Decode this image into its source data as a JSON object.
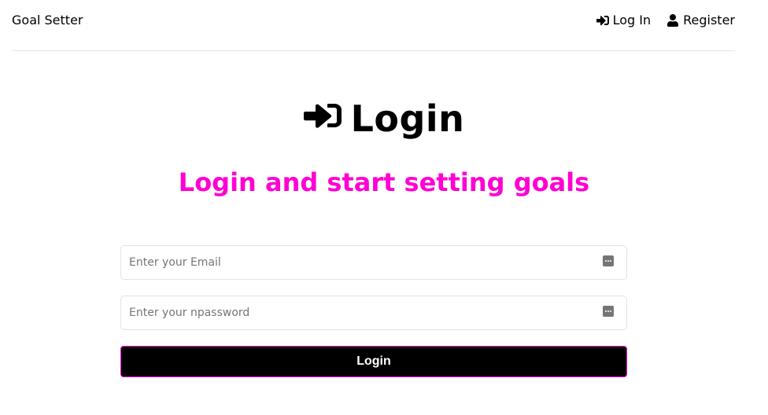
{
  "header": {
    "brand": "Goal Setter",
    "nav": {
      "login_label": "Log In",
      "register_label": "Register"
    }
  },
  "main": {
    "title": "Login",
    "subtitle": "Login and start setting goals",
    "email": {
      "placeholder": "Enter your Email",
      "value": ""
    },
    "password": {
      "placeholder": "Enter your npassword",
      "value": ""
    },
    "submit_label": "Login"
  },
  "colors": {
    "accent": "#ff00d4",
    "button_bg": "#000000",
    "text": "#000000"
  },
  "icons": {
    "login": "sign-in-icon",
    "register": "user-icon",
    "field_autofill": "password-manager-icon"
  }
}
